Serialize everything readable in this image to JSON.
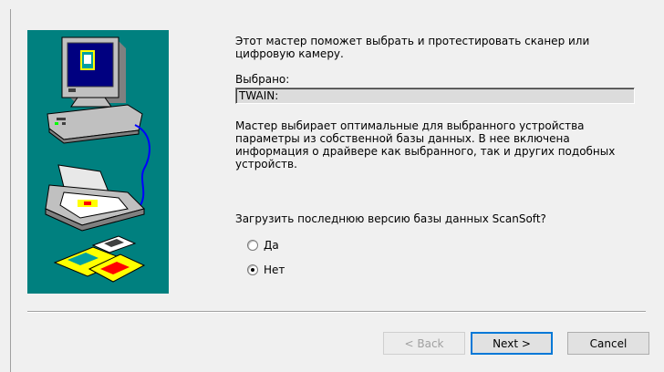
{
  "wizard": {
    "intro": "Этот мастер поможет выбрать и протестировать сканер или цифровую камеру.",
    "selected_label": "Выбрано:",
    "selected_value": "TWAIN:",
    "description": "Мастер выбирает оптимальные для выбранного устройства параметры из собственной базы данных. В нее включена информация о драйвере как выбранного, так и других подобных устройств.",
    "question": "Загрузить последнюю версию базы данных ScanSoft?",
    "options": [
      {
        "label": "Да",
        "checked": false
      },
      {
        "label": "Нет",
        "checked": true
      }
    ]
  },
  "buttons": {
    "back": "< Back",
    "next": "Next >",
    "cancel": "Cancel"
  },
  "colors": {
    "panel_background": "#00807f",
    "dialog_background": "#f0f0f0"
  },
  "icons": [
    "computer-icon",
    "scanner-icon",
    "photos-icon"
  ]
}
